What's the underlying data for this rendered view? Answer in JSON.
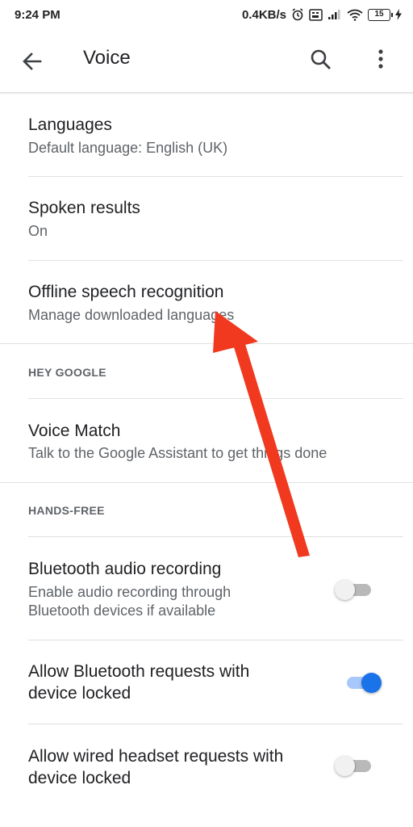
{
  "status_bar": {
    "time": "9:24 PM",
    "network_speed": "0.4KB/s",
    "battery_level": "15",
    "icons": [
      "alarm-icon",
      "sim-icon",
      "signal-icon",
      "wifi-icon",
      "battery-icon",
      "charging-icon"
    ]
  },
  "app_bar": {
    "title": "Voice",
    "icons": [
      "back-arrow-icon",
      "search-icon",
      "more-vert-icon"
    ]
  },
  "settings": {
    "languages": {
      "title": "Languages",
      "subtitle": "Default language: English (UK)"
    },
    "spoken_results": {
      "title": "Spoken results",
      "subtitle": "On"
    },
    "offline_speech": {
      "title": "Offline speech recognition",
      "subtitle": "Manage downloaded languages"
    },
    "hey_google_header": "HEY GOOGLE",
    "voice_match": {
      "title": "Voice Match",
      "subtitle": "Talk to the Google Assistant to get things done"
    },
    "hands_free_header": "HANDS-FREE",
    "bluetooth_audio": {
      "title": "Bluetooth audio recording",
      "subtitle_line1": "Enable audio recording through",
      "subtitle_line2": "Bluetooth devices if available",
      "enabled": false
    },
    "bluetooth_requests": {
      "title_line1": "Allow Bluetooth requests with",
      "title_line2": "device locked",
      "enabled": true
    },
    "wired_headset": {
      "title_line1": "Allow wired headset requests with",
      "title_line2": "device locked",
      "enabled": false
    }
  },
  "colors": {
    "accent": "#1a73e8",
    "accent_track": "#a8c7fa",
    "toggle_off_thumb": "#f1f1f1",
    "toggle_off_track": "#b9b9b9",
    "annotation_arrow": "#f0391f"
  }
}
